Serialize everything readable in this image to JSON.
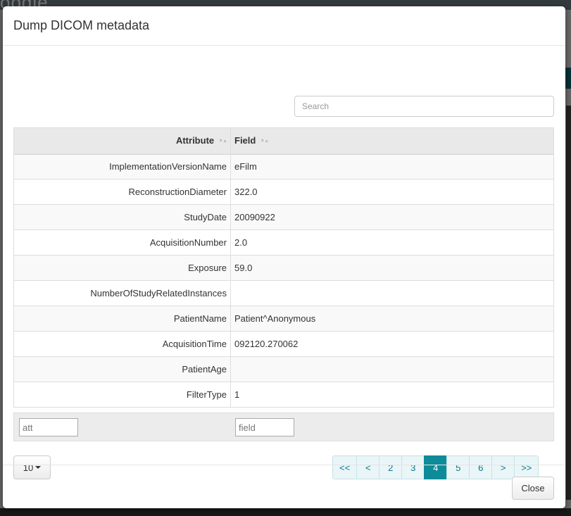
{
  "background": {
    "logo_text": "oogle"
  },
  "modal": {
    "title": "Dump DICOM metadata",
    "search_placeholder": "Search",
    "columns": {
      "attribute": "Attribute",
      "field": "Field"
    },
    "rows": [
      {
        "attribute": "ImplementationVersionName",
        "field": "eFilm"
      },
      {
        "attribute": "ReconstructionDiameter",
        "field": "322.0"
      },
      {
        "attribute": "StudyDate",
        "field": "20090922"
      },
      {
        "attribute": "AcquisitionNumber",
        "field": "2.0"
      },
      {
        "attribute": "Exposure",
        "field": "59.0"
      },
      {
        "attribute": "NumberOfStudyRelatedInstances",
        "field": ""
      },
      {
        "attribute": "PatientName",
        "field": "Patient^Anonymous"
      },
      {
        "attribute": "AcquisitionTime",
        "field": "092120.270062"
      },
      {
        "attribute": "PatientAge",
        "field": ""
      },
      {
        "attribute": "FilterType",
        "field": "1"
      }
    ],
    "filters": {
      "attribute_placeholder": "att",
      "field_placeholder": "field"
    },
    "page_size": "10",
    "pagination": {
      "first": "<<",
      "prev": "<",
      "pages": [
        "2",
        "3",
        "4",
        "5",
        "6"
      ],
      "current_page": "4",
      "next": ">",
      "last": ">>"
    },
    "close_label": "Close"
  },
  "colors": {
    "accent": "#0e8b98",
    "header_bg": "#e9e9e9"
  }
}
